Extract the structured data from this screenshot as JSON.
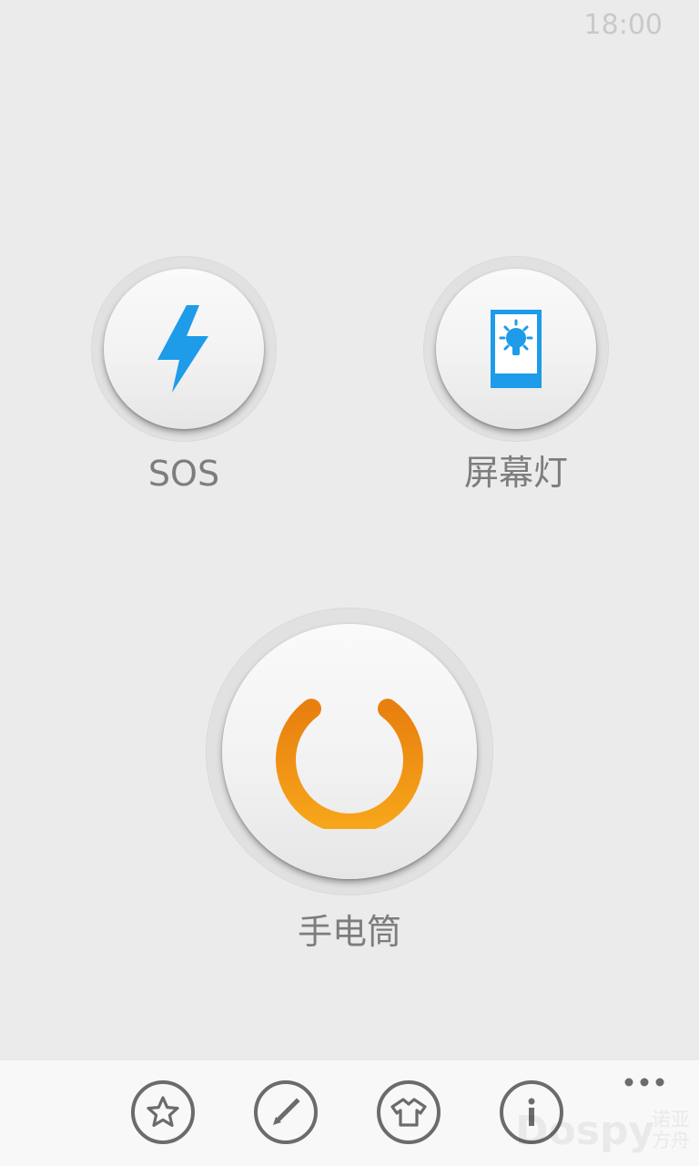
{
  "status_bar": {
    "time": "18:00"
  },
  "buttons": {
    "sos": {
      "label": "SOS",
      "icon": "lightning-icon"
    },
    "screen_light": {
      "label": "屏幕灯",
      "icon": "screen-bulb-icon"
    },
    "flashlight": {
      "label": "手电筒",
      "icon": "power-icon"
    }
  },
  "app_bar": {
    "items": [
      {
        "icon": "star-icon"
      },
      {
        "icon": "pencil-icon"
      },
      {
        "icon": "shirt-icon"
      },
      {
        "icon": "info-icon"
      }
    ],
    "more_icon": "more-dots-icon"
  },
  "watermark": {
    "brand": "Dospy",
    "chinese_line1": "诺亚",
    "chinese_line2": "方舟"
  },
  "colors": {
    "background": "#ebebeb",
    "accent_blue": "#1e9be9",
    "accent_orange": "#f39c12",
    "label_gray": "#7d7d7d"
  }
}
